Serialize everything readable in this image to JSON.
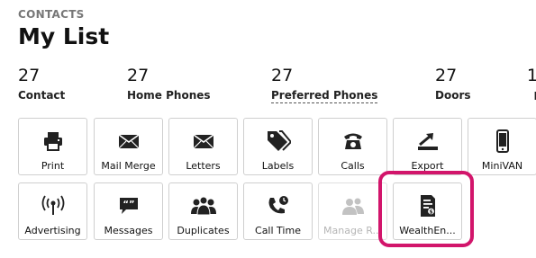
{
  "header": {
    "section": "CONTACTS",
    "title": "My List"
  },
  "stats": [
    {
      "value": "27",
      "label": "Contact"
    },
    {
      "value": "27",
      "label": "Home Phones"
    },
    {
      "value": "27",
      "label": "Preferred Phones"
    },
    {
      "value": "27",
      "label": "Doors"
    }
  ],
  "stats_partial": {
    "value": "1",
    "label": "I"
  },
  "actions": [
    {
      "label": "Print",
      "icon": "printer-icon"
    },
    {
      "label": "Mail Merge",
      "icon": "envelope-icon"
    },
    {
      "label": "Letters",
      "icon": "envelope-icon"
    },
    {
      "label": "Labels",
      "icon": "tags-icon"
    },
    {
      "label": "Calls",
      "icon": "telephone-icon"
    },
    {
      "label": "Export",
      "icon": "export-icon"
    },
    {
      "label": "MiniVAN",
      "icon": "mobile-phone-icon"
    },
    {
      "label": "Advertising",
      "icon": "broadcast-icon"
    },
    {
      "label": "Messages",
      "icon": "chat-bubble-icon"
    },
    {
      "label": "Duplicates",
      "icon": "people-group-icon"
    },
    {
      "label": "Call Time",
      "icon": "phone-clock-icon"
    },
    {
      "label": "Manage R...",
      "icon": "users-icon"
    },
    {
      "label": "WealthEn...",
      "icon": "document-dollar-icon"
    }
  ],
  "colors": {
    "highlight": "#d2156b",
    "disabled": "#b5b5b5",
    "border": "#cfcfcf"
  }
}
